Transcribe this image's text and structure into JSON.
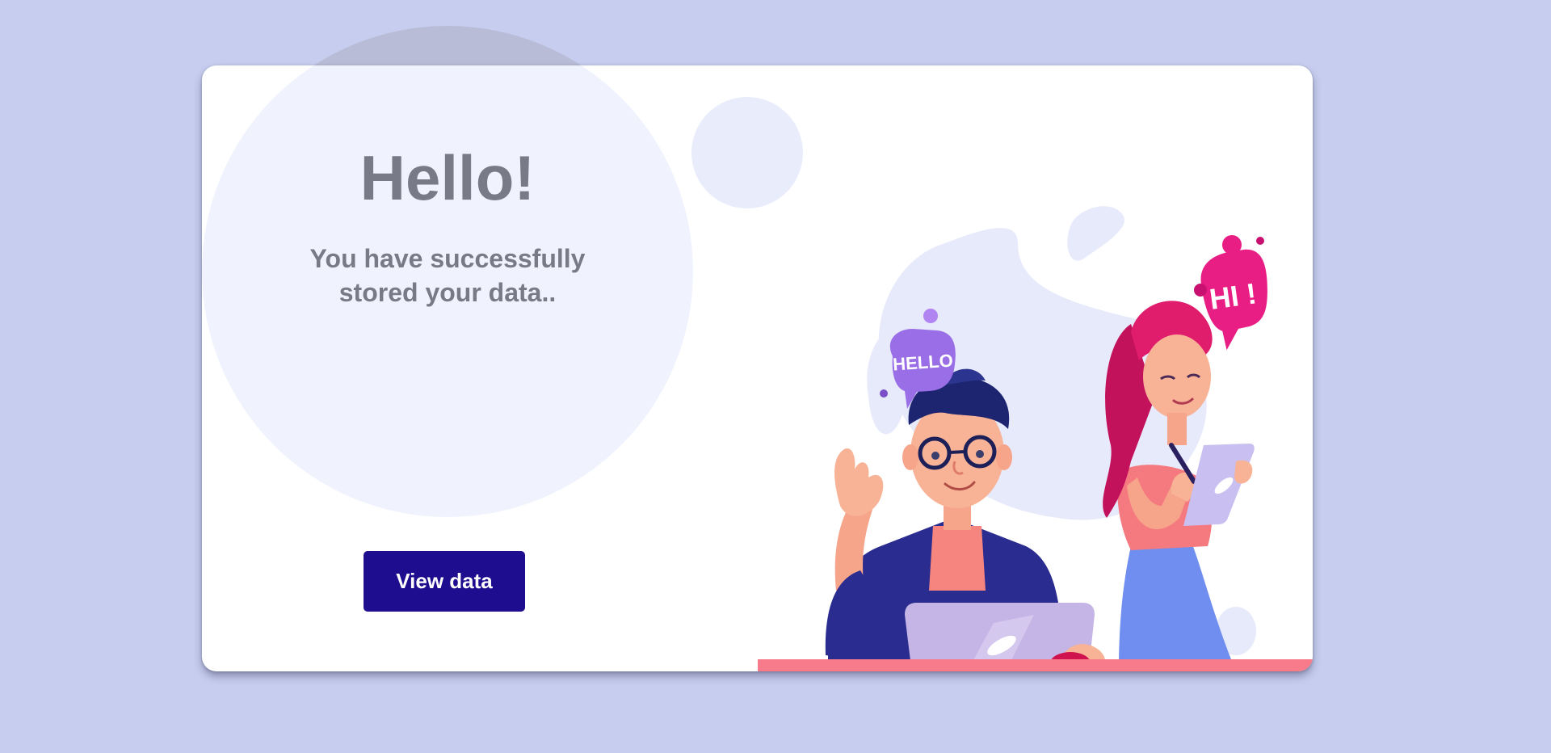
{
  "card": {
    "title": "Hello!",
    "message_line1": "You have successfully",
    "message_line2": "stored your data..",
    "view_button_label": "View data"
  },
  "illustration": {
    "bubble_left_text": "HELLO",
    "bubble_right_text": "HI !"
  },
  "colors": {
    "page_background": "#c6cdee",
    "card_background": "#ffffff",
    "button_background": "#1e0e8f",
    "text_gray": "#787a87",
    "accent_floor": "#f77b8a"
  }
}
